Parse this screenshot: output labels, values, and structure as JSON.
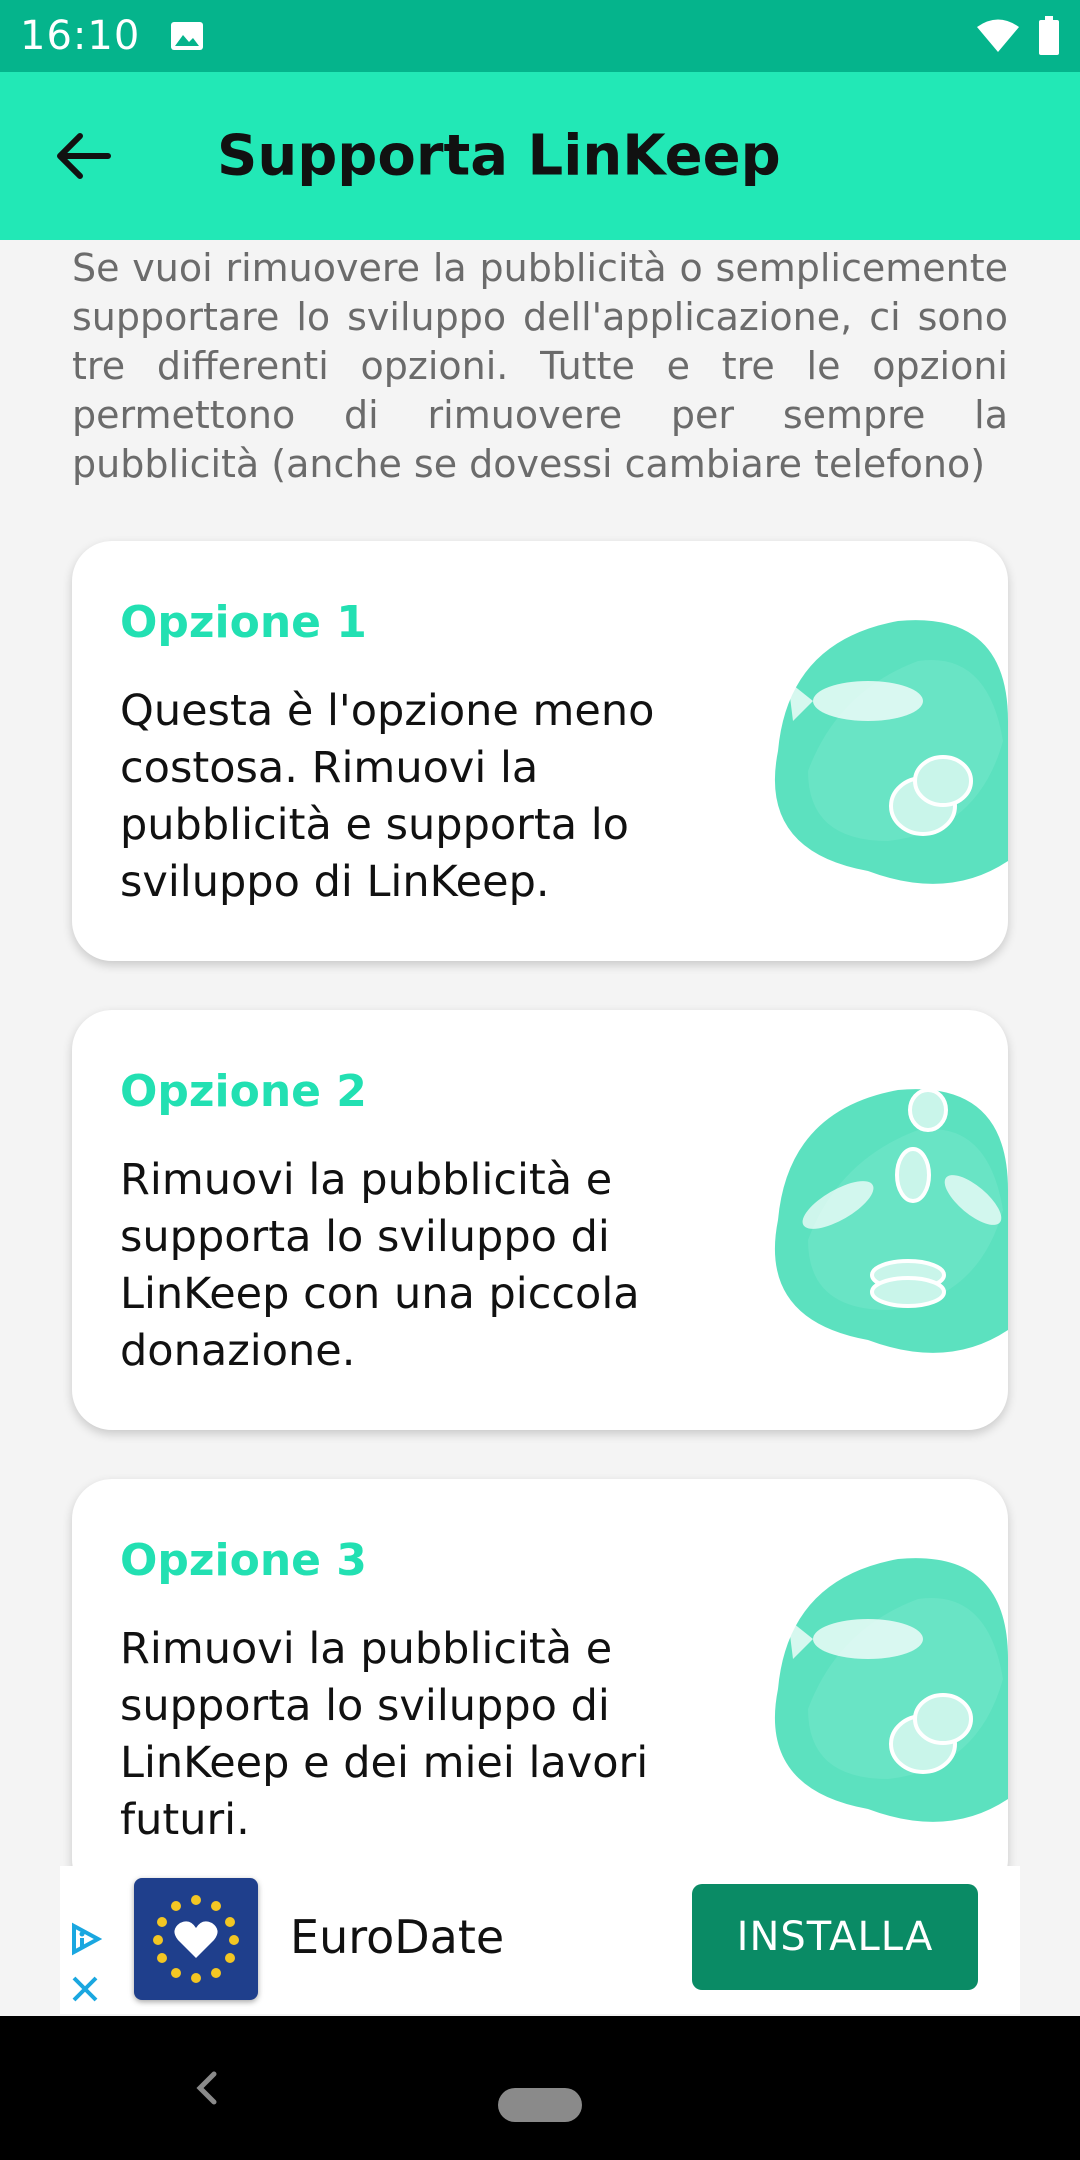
{
  "status_bar": {
    "time": "16:10"
  },
  "app_bar": {
    "title": "Supporta LinKeep"
  },
  "intro_text": "Se vuoi rimuovere la pubblicità o semplicemente supportare lo sviluppo dell'applicazione, ci sono tre differenti opzioni. Tutte e tre le opzioni permettono di rimuovere per sempre la pubblicità (anche se dovessi cambiare telefono)",
  "options": [
    {
      "title": "Opzione 1",
      "description": "Questa è l'opzione meno costosa. Rimuovi la pubblicità e supporta lo sviluppo di LinKeep."
    },
    {
      "title": "Opzione 2",
      "description": "Rimuovi la pubblicità e supporta lo sviluppo di LinKeep con una piccola donazione."
    },
    {
      "title": "Opzione 3",
      "description": "Rimuovi la pubblicità e supporta lo sviluppo di LinKeep e dei miei lavori futuri."
    }
  ],
  "ad": {
    "app_name": "EuroDate",
    "install_label": "INSTALLA"
  },
  "colors": {
    "status_bar": "#05b48c",
    "app_bar": "#22e8b6",
    "accent": "#22e0b2",
    "install_button": "#0a8b65"
  },
  "icons": {
    "back": "arrow-left-icon",
    "wifi": "wifi-icon",
    "battery": "battery-icon",
    "image": "image-icon",
    "ad_info": "ad-choices-icon",
    "ad_close": "close-icon"
  }
}
